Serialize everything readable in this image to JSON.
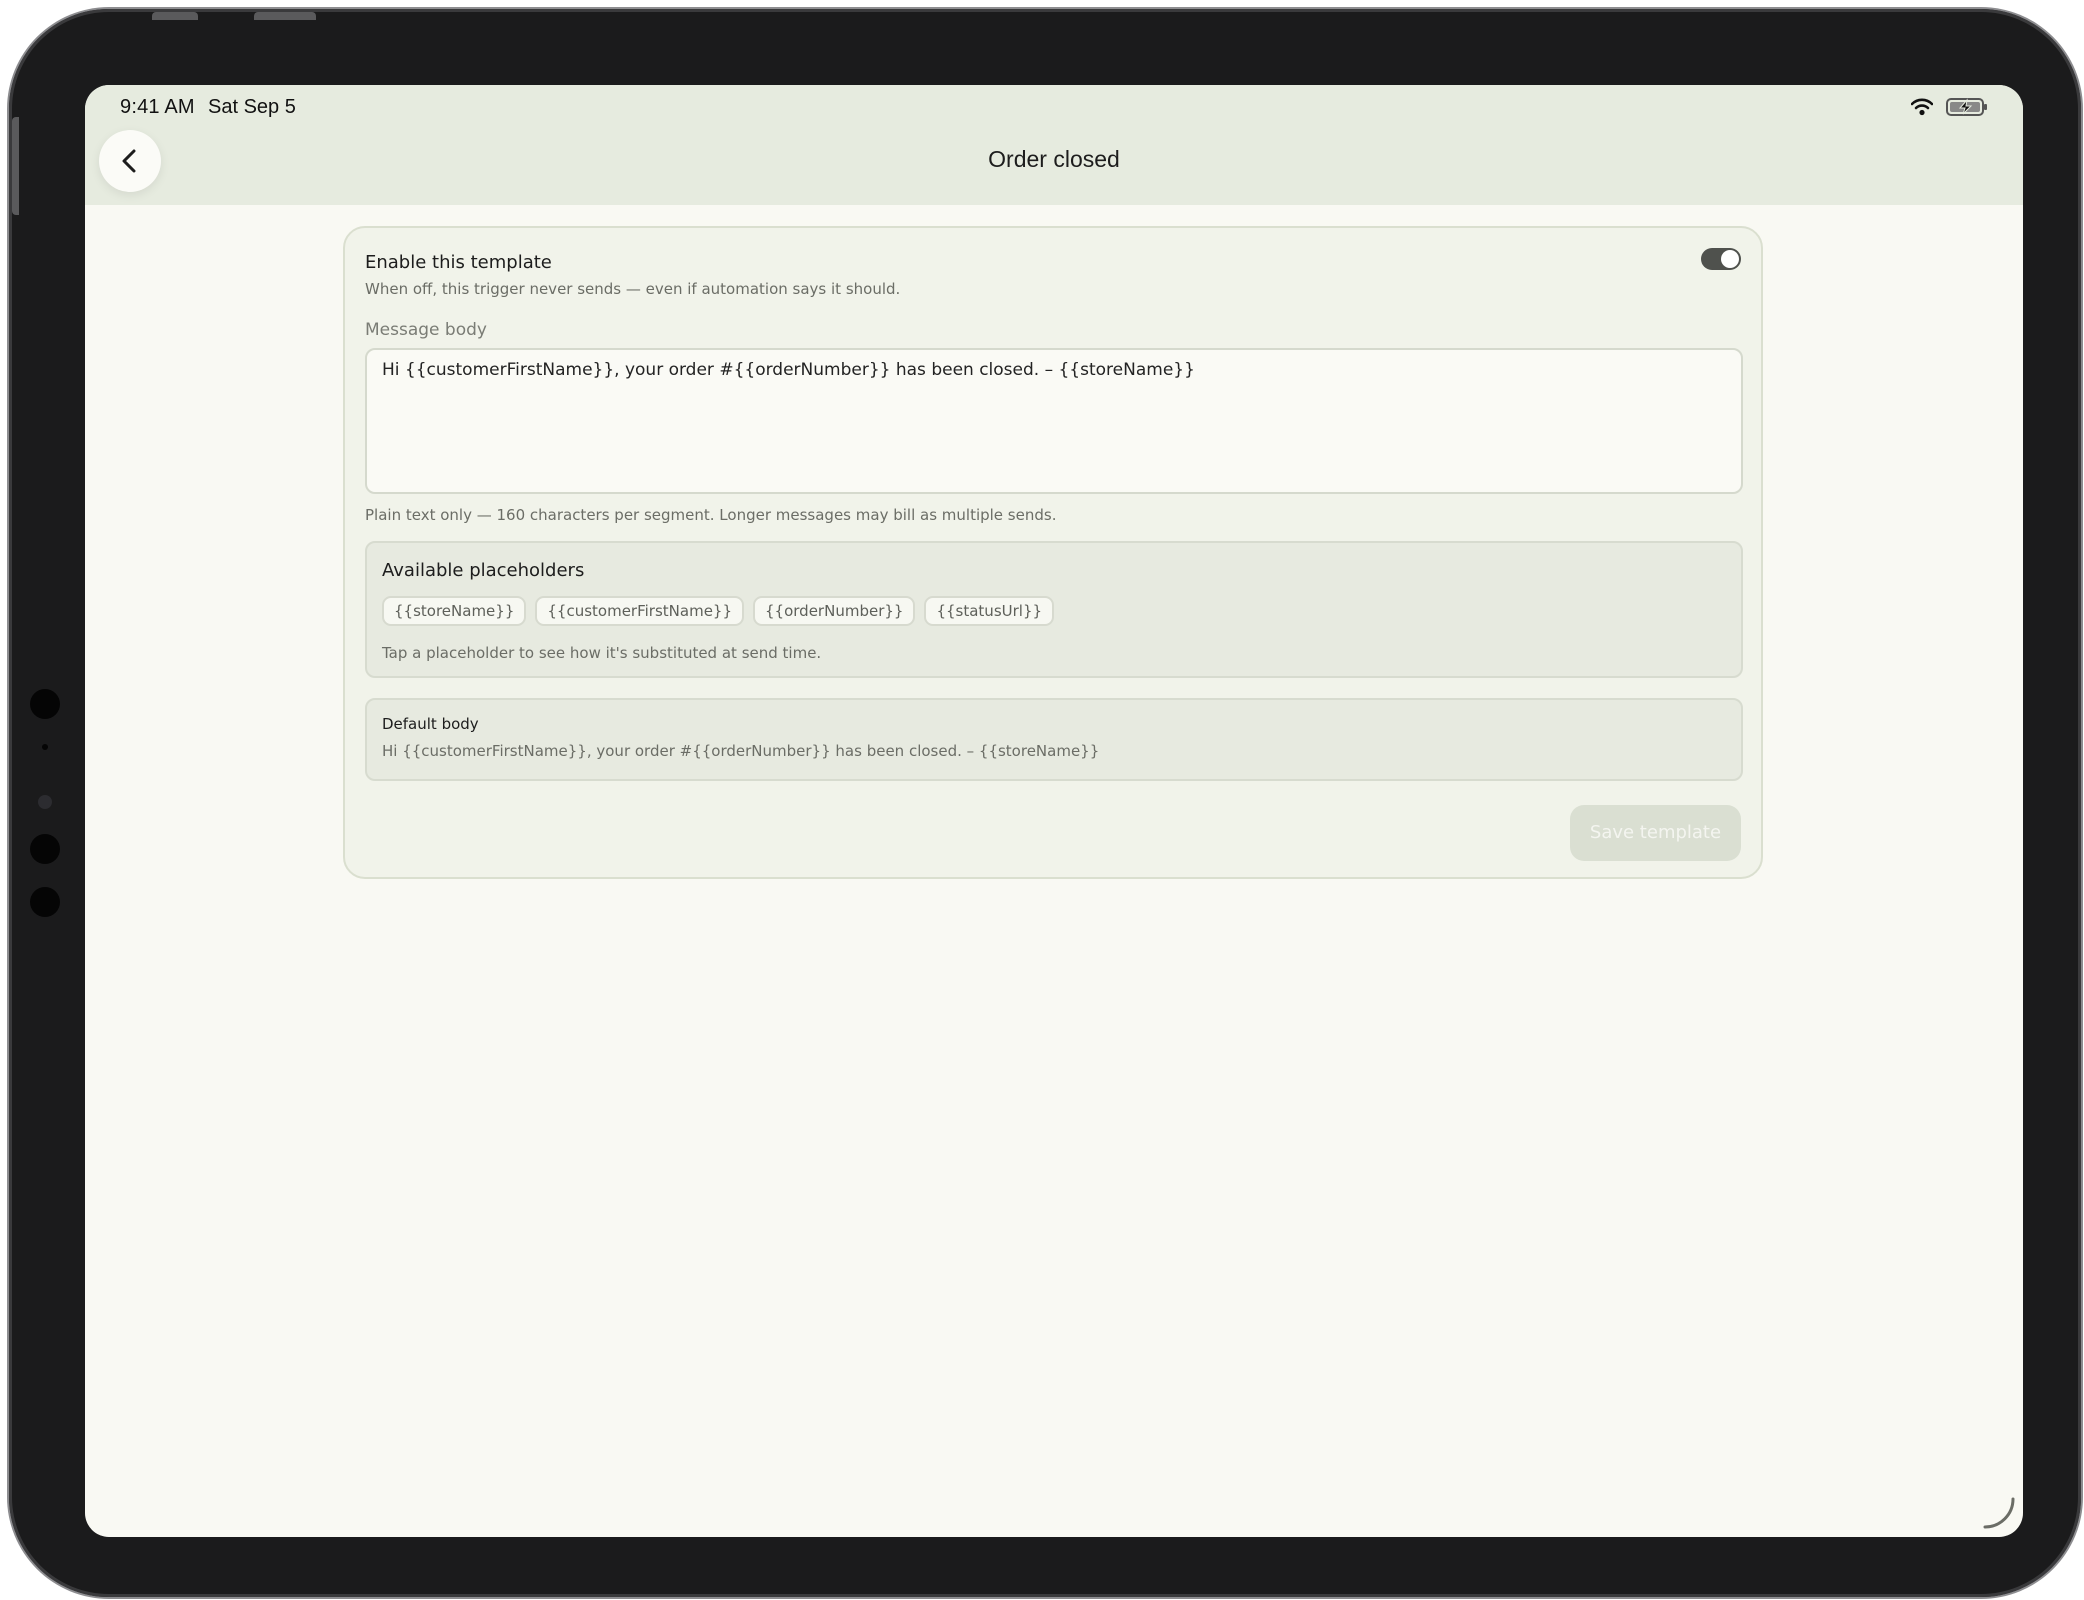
{
  "status_bar": {
    "time": "9:41 AM",
    "date": "Sat Sep 5"
  },
  "header": {
    "title": "Order closed",
    "back_icon": "chevron-left-icon"
  },
  "template": {
    "enabled": true,
    "enable_title": "Enable this template",
    "enable_description": "When off, this trigger never sends — even if automation says it should.",
    "message_label": "Message body",
    "message_body": "Hi {{customerFirstName}}, your order #{{orderNumber}} has been closed. – {{storeName}}",
    "message_hint": "Plain text only — 160 characters per segment. Longer messages may bill as multiple sends."
  },
  "placeholders": {
    "title": "Available placeholders",
    "items": [
      "{{storeName}}",
      "{{customerFirstName}}",
      "{{orderNumber}}",
      "{{statusUrl}}"
    ],
    "hint": "Tap a placeholder to see how it's substituted at send time."
  },
  "default_body": {
    "title": "Default body",
    "text": "Hi {{customerFirstName}}, your order #{{orderNumber}} has been closed. – {{storeName}}"
  },
  "actions": {
    "save_label": "Save template",
    "save_disabled": true
  },
  "colors": {
    "header_bg": "#e6ebdf",
    "page_bg": "#f9f9f3",
    "toggle_on": "#4f514d"
  }
}
